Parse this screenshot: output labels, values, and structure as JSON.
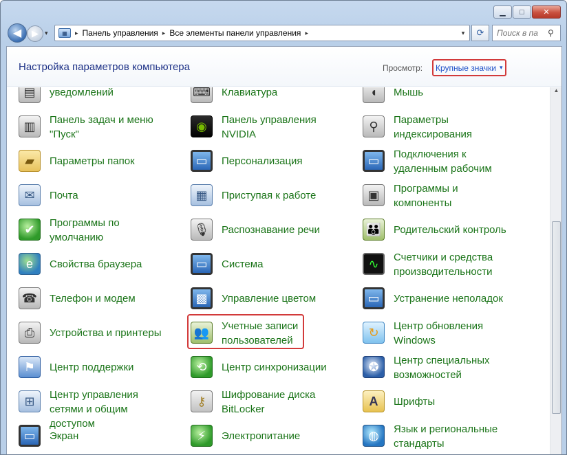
{
  "window": {
    "caption_buttons": {
      "minimize": "▁",
      "maximize": "□",
      "close": "✕"
    }
  },
  "navbar": {
    "back_glyph": "◀",
    "forward_glyph": "▶",
    "recent_glyph": "▾",
    "breadcrumb": [
      "Панель управления",
      "Все элементы панели управления"
    ],
    "separator": "▸",
    "dropdown_glyph": "▾",
    "refresh_glyph": "⟳",
    "search_placeholder": "Поиск в па",
    "search_icon": "⚲"
  },
  "header": {
    "title": "Настройка параметров компьютера",
    "view_label": "Просмотр:",
    "view_value": "Крупные значки",
    "view_caret": "▾"
  },
  "items": {
    "col1": [
      {
        "label": "уведомлений",
        "icon": "notification-icon",
        "glyph": "▤",
        "style": "ic-gray",
        "lines": 1
      },
      {
        "label": "Панель задач и меню \"Пуск\"",
        "icon": "taskbar-icon",
        "glyph": "▥",
        "style": "ic-gray",
        "lines": 2
      },
      {
        "label": "Параметры папок",
        "icon": "folder-icon",
        "glyph": "▰",
        "style": "ic-folder",
        "lines": 1
      },
      {
        "label": "Почта",
        "icon": "mail-icon",
        "glyph": "✉",
        "style": "ic-mail",
        "lines": 1
      },
      {
        "label": "Программы по умолчанию",
        "icon": "default-programs-icon",
        "glyph": "✔",
        "style": "ic-green",
        "lines": 2
      },
      {
        "label": "Свойства браузера",
        "icon": "internet-options-icon",
        "glyph": "e",
        "style": "ic-globe",
        "lines": 1
      },
      {
        "label": "Телефон и модем",
        "icon": "phone-modem-icon",
        "glyph": "☎",
        "style": "ic-gray",
        "lines": 1
      },
      {
        "label": "Устройства и принтеры",
        "icon": "printer-icon",
        "glyph": "⎙",
        "style": "ic-gray",
        "lines": 1
      },
      {
        "label": "Центр поддержки",
        "icon": "action-center-flag-icon",
        "glyph": "⚑",
        "style": "ic-flag",
        "lines": 1
      },
      {
        "label": "Центр управления сетями и общим доступом",
        "icon": "network-icon",
        "glyph": "⊞",
        "style": "ic-mail",
        "lines": 2
      },
      {
        "label": "Экран",
        "icon": "display-icon",
        "glyph": "▭",
        "style": "ic-monitor",
        "lines": 1
      }
    ],
    "col2": [
      {
        "label": "Клавиатура",
        "icon": "keyboard-icon",
        "glyph": "⌨",
        "style": "ic-gray",
        "lines": 1
      },
      {
        "label": "Панель управления NVIDIA",
        "icon": "nvidia-icon",
        "glyph": "◉",
        "style": "ic-nvidia",
        "lines": 2
      },
      {
        "label": "Персонализация",
        "icon": "personalization-icon",
        "glyph": "▭",
        "style": "ic-monitor",
        "lines": 1
      },
      {
        "label": "Приступая к работе",
        "icon": "getting-started-icon",
        "glyph": "▦",
        "style": "ic-mail",
        "lines": 1
      },
      {
        "label": "Распознавание речи",
        "icon": "microphone-icon",
        "glyph": "🎙",
        "style": "ic-gray",
        "lines": 1
      },
      {
        "label": "Система",
        "icon": "system-icon",
        "glyph": "▭",
        "style": "ic-monitor",
        "lines": 1
      },
      {
        "label": "Управление цветом",
        "icon": "color-management-icon",
        "glyph": "▩",
        "style": "ic-monitor",
        "lines": 1
      },
      {
        "label": "Учетные записи пользователей",
        "icon": "user-accounts-icon",
        "glyph": "👥",
        "style": "ic-users",
        "lines": 2
      },
      {
        "label": "Центр синхронизации",
        "icon": "sync-center-icon",
        "glyph": "⟲",
        "style": "ic-green",
        "lines": 1
      },
      {
        "label": "Шифрование диска BitLocker",
        "icon": "bitlocker-key-icon",
        "glyph": "⚷",
        "style": "ic-key",
        "lines": 2
      },
      {
        "label": "Электропитание",
        "icon": "power-options-icon",
        "glyph": "⚡",
        "style": "ic-green",
        "lines": 1
      }
    ],
    "col3": [
      {
        "label": "Мышь",
        "icon": "mouse-icon",
        "glyph": "◖",
        "style": "ic-gray",
        "lines": 1
      },
      {
        "label": "Параметры индексирования",
        "icon": "indexing-icon",
        "glyph": "⚲",
        "style": "ic-gray",
        "lines": 2
      },
      {
        "label": "Подключения к удаленным рабочим",
        "icon": "remote-desktop-icon",
        "glyph": "▭",
        "style": "ic-monitor",
        "lines": 2
      },
      {
        "label": "Программы и компоненты",
        "icon": "programs-features-icon",
        "glyph": "▣",
        "style": "ic-gray",
        "lines": 2
      },
      {
        "label": "Родительский контроль",
        "icon": "parental-controls-icon",
        "glyph": "👪",
        "style": "ic-users",
        "lines": 1
      },
      {
        "label": "Счетчики и средства производительности",
        "icon": "performance-icon",
        "glyph": "∿",
        "style": "ic-perf",
        "lines": 2
      },
      {
        "label": "Устранение неполадок",
        "icon": "troubleshooting-icon",
        "glyph": "▭",
        "style": "ic-monitor",
        "lines": 1
      },
      {
        "label": "Центр обновления Windows",
        "icon": "windows-update-icon",
        "glyph": "↻",
        "style": "ic-update",
        "lines": 2
      },
      {
        "label": "Центр специальных возможностей",
        "icon": "ease-of-access-icon",
        "glyph": "✪",
        "style": "ic-access",
        "lines": 2
      },
      {
        "label": "Шрифты",
        "icon": "fonts-icon",
        "glyph": "A",
        "style": "ic-font",
        "lines": 1
      },
      {
        "label": "Язык и региональные стандарты",
        "icon": "region-language-icon",
        "glyph": "◍",
        "style": "ic-lang",
        "lines": 2
      }
    ]
  },
  "scrollbar": {
    "up_glyph": "▲"
  }
}
